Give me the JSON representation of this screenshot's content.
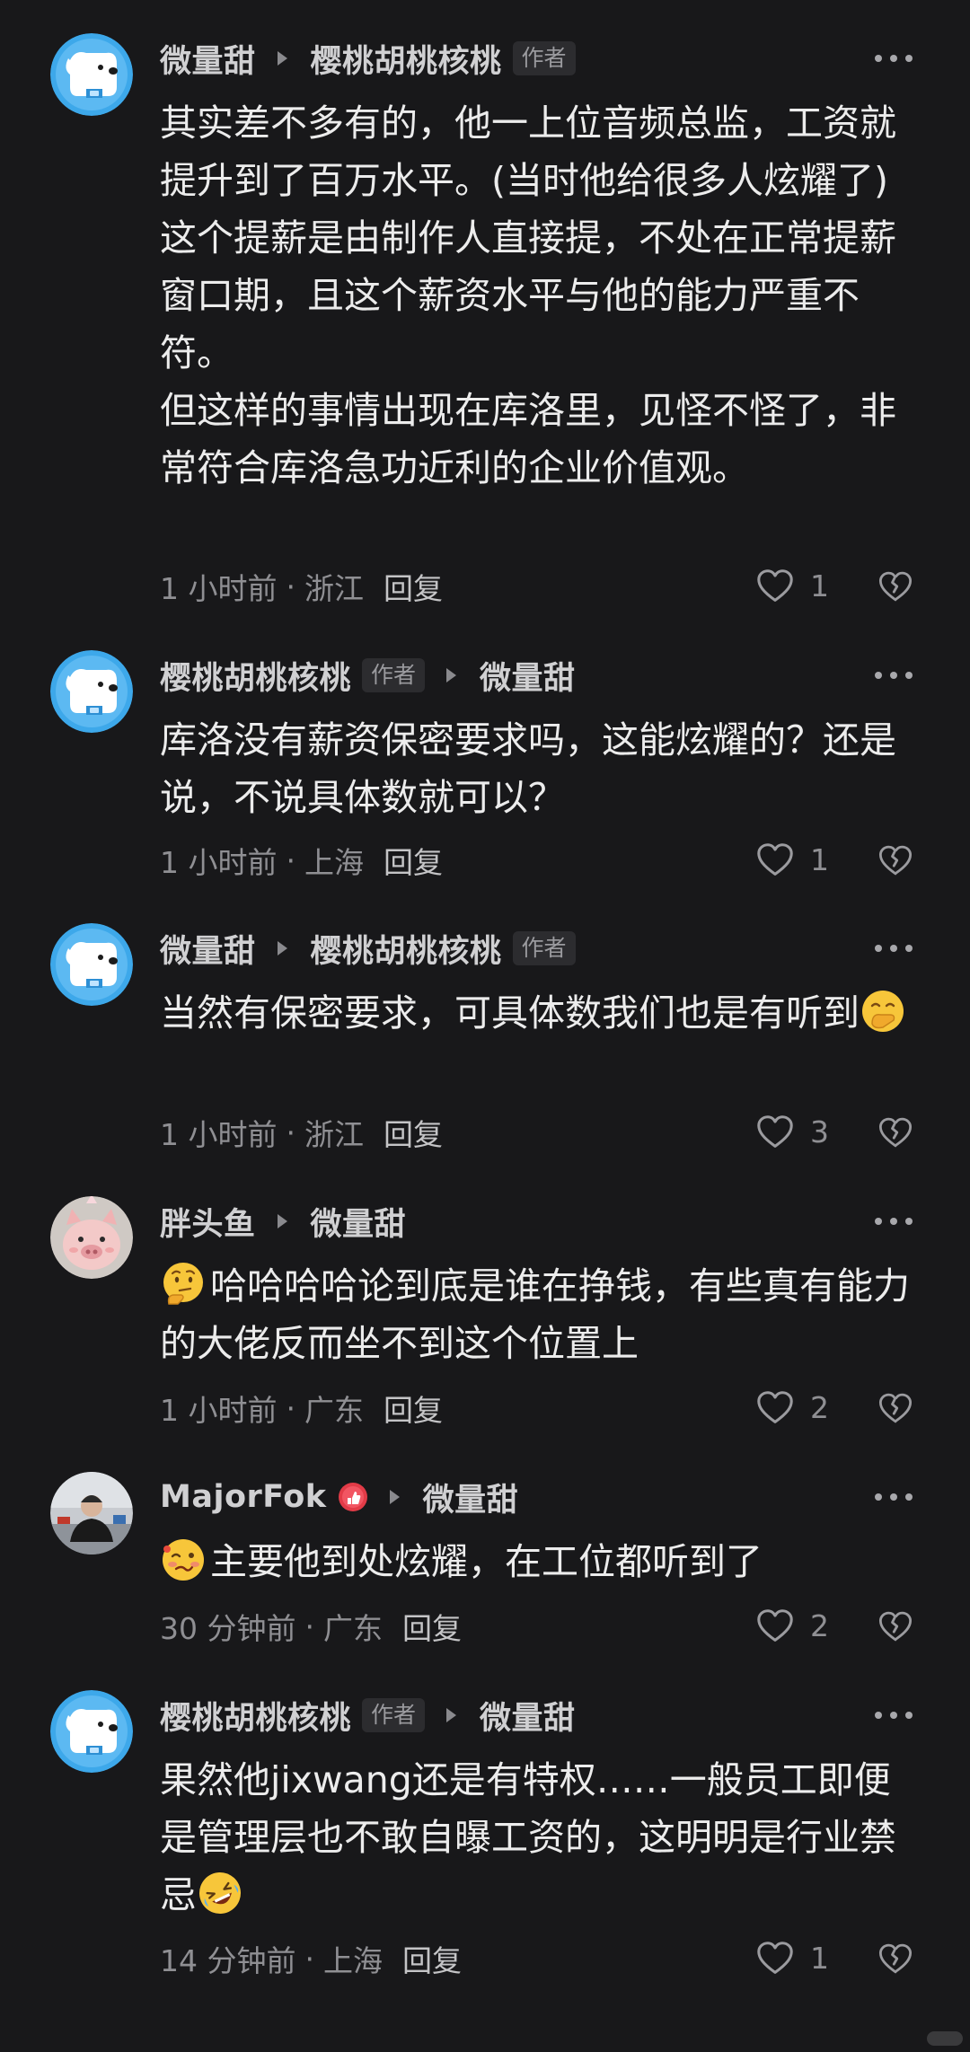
{
  "comments": [
    {
      "author": "微量甜",
      "reply_to": "樱桃胡桃核桃",
      "reply_to_badge": "作者",
      "paragraphs": [
        "其实差不多有的，他一上位音频总监，工资就提升到了百万水平。(当时他给很多人炫耀了)",
        "这个提薪是由制作人直接提，不处在正常提薪窗口期，且这个薪资水平与他的能力严重不符。",
        "但这样的事情出现在库洛里，见怪不怪了，非常符合库洛急功近利的企业价值观。"
      ],
      "time": "1 小时前",
      "location": "浙江",
      "reply_label": "回复",
      "likes": "1",
      "avatar": "dog-avatar"
    },
    {
      "author": "樱桃胡桃核桃",
      "author_badge": "作者",
      "reply_to": "微量甜",
      "paragraphs": [
        "库洛没有薪资保密要求吗，这能炫耀的？还是说，不说具体数就可以？"
      ],
      "time": "1 小时前",
      "location": "上海",
      "reply_label": "回复",
      "likes": "1",
      "avatar": "dog-avatar"
    },
    {
      "author": "微量甜",
      "reply_to": "樱桃胡桃核桃",
      "reply_to_badge": "作者",
      "text": "当然有保密要求，可具体数我们也是有听到",
      "trailing_emoji": "hand-over-mouth-emoji",
      "time": "1 小时前",
      "location": "浙江",
      "reply_label": "回复",
      "likes": "3",
      "avatar": "dog-avatar"
    },
    {
      "author": "胖头鱼",
      "reply_to": "微量甜",
      "leading_emoji": "thinking-emoji",
      "text": "哈哈哈哈论到底是谁在挣钱，有些真有能力的大佬反而坐不到这个位置上",
      "time": "1 小时前",
      "location": "广东",
      "reply_label": "回复",
      "likes": "2",
      "avatar": "pig-avatar"
    },
    {
      "author": "MajorFok",
      "author_level_icon": "level-badge-icon",
      "reply_to": "微量甜",
      "leading_emoji": "woozy-emoji",
      "text": "主要他到处炫耀，在工位都听到了",
      "time": "30 分钟前",
      "location": "广东",
      "reply_label": "回复",
      "likes": "2",
      "avatar": "photo-avatar"
    },
    {
      "author": "樱桃胡桃核桃",
      "author_badge": "作者",
      "reply_to": "微量甜",
      "text": "果然他jixwang还是有特权……一般员工即便是管理层也不敢自曝工资的，这明明是行业禁忌",
      "trailing_emoji": "rolling-laughing-emoji",
      "time": "14 分钟前",
      "location": "上海",
      "reply_label": "回复",
      "likes": "1",
      "avatar": "dog-avatar"
    }
  ],
  "colors": {
    "background": "#18181a",
    "username": "#d0d0d2",
    "body_text": "#ececec",
    "meta_text": "#8f8f93"
  }
}
